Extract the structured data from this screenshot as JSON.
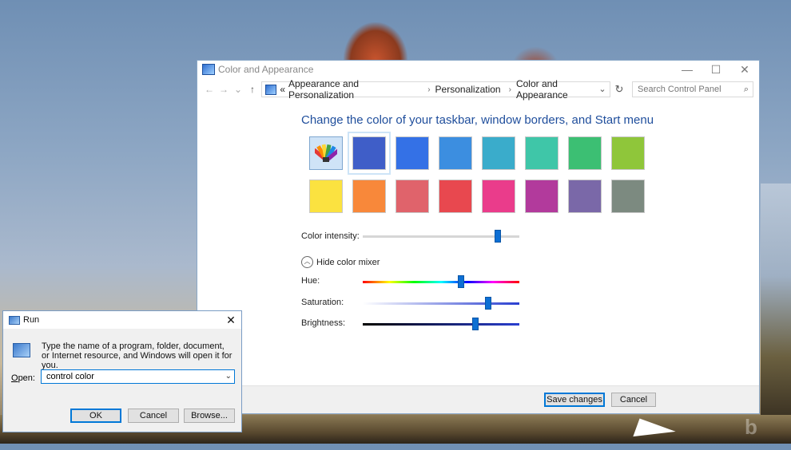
{
  "window": {
    "title": "Color and Appearance",
    "controls": {
      "minimize": "—",
      "maximize": "☐",
      "close": "✕"
    }
  },
  "nav": {
    "back": "←",
    "forward": "→",
    "recent": "⌄",
    "up": "↑"
  },
  "address": {
    "prefix": "«",
    "crumbs": [
      "Appearance and Personalization",
      "Personalization",
      "Color and Appearance"
    ],
    "separator": "›",
    "dropdown": "⌄",
    "refresh": "↻"
  },
  "search": {
    "placeholder": "Search Control Panel",
    "icon": "⌕"
  },
  "heading": "Change the color of your taskbar, window borders, and Start menu",
  "swatches": {
    "row1": [
      "custom",
      "#3f5ec8",
      "#3471e6",
      "#3c8ee0",
      "#3aaccb",
      "#3fc6a8",
      "#3cbf73",
      "#8fc63a"
    ],
    "row2": [
      "#fbe240",
      "#f8883a",
      "#e0636b",
      "#e8484f",
      "#ea3c8b",
      "#b23a9c",
      "#7a68a8",
      "#7c8a80"
    ],
    "selected_index": 1
  },
  "color_intensity": {
    "label": "Color intensity:",
    "value": 0.86
  },
  "mixer_toggle": {
    "label": "Hide color mixer",
    "icon": "chevron-up-icon"
  },
  "hue": {
    "label": "Hue:",
    "value": 0.63
  },
  "saturation": {
    "label": "Saturation:",
    "value": 0.8
  },
  "brightness": {
    "label": "Brightness:",
    "value": 0.72
  },
  "buttons": {
    "save": "Save changes",
    "cancel": "Cancel"
  },
  "run": {
    "title": "Run",
    "close": "✕",
    "description": "Type the name of a program, folder, document, or Internet resource, and Windows will open it for you.",
    "open_label_key": "O",
    "open_label_rest": "pen:",
    "input_value": "control color",
    "dropdown": "⌄",
    "ok": "OK",
    "cancel": "Cancel",
    "browse": "Browse..."
  }
}
